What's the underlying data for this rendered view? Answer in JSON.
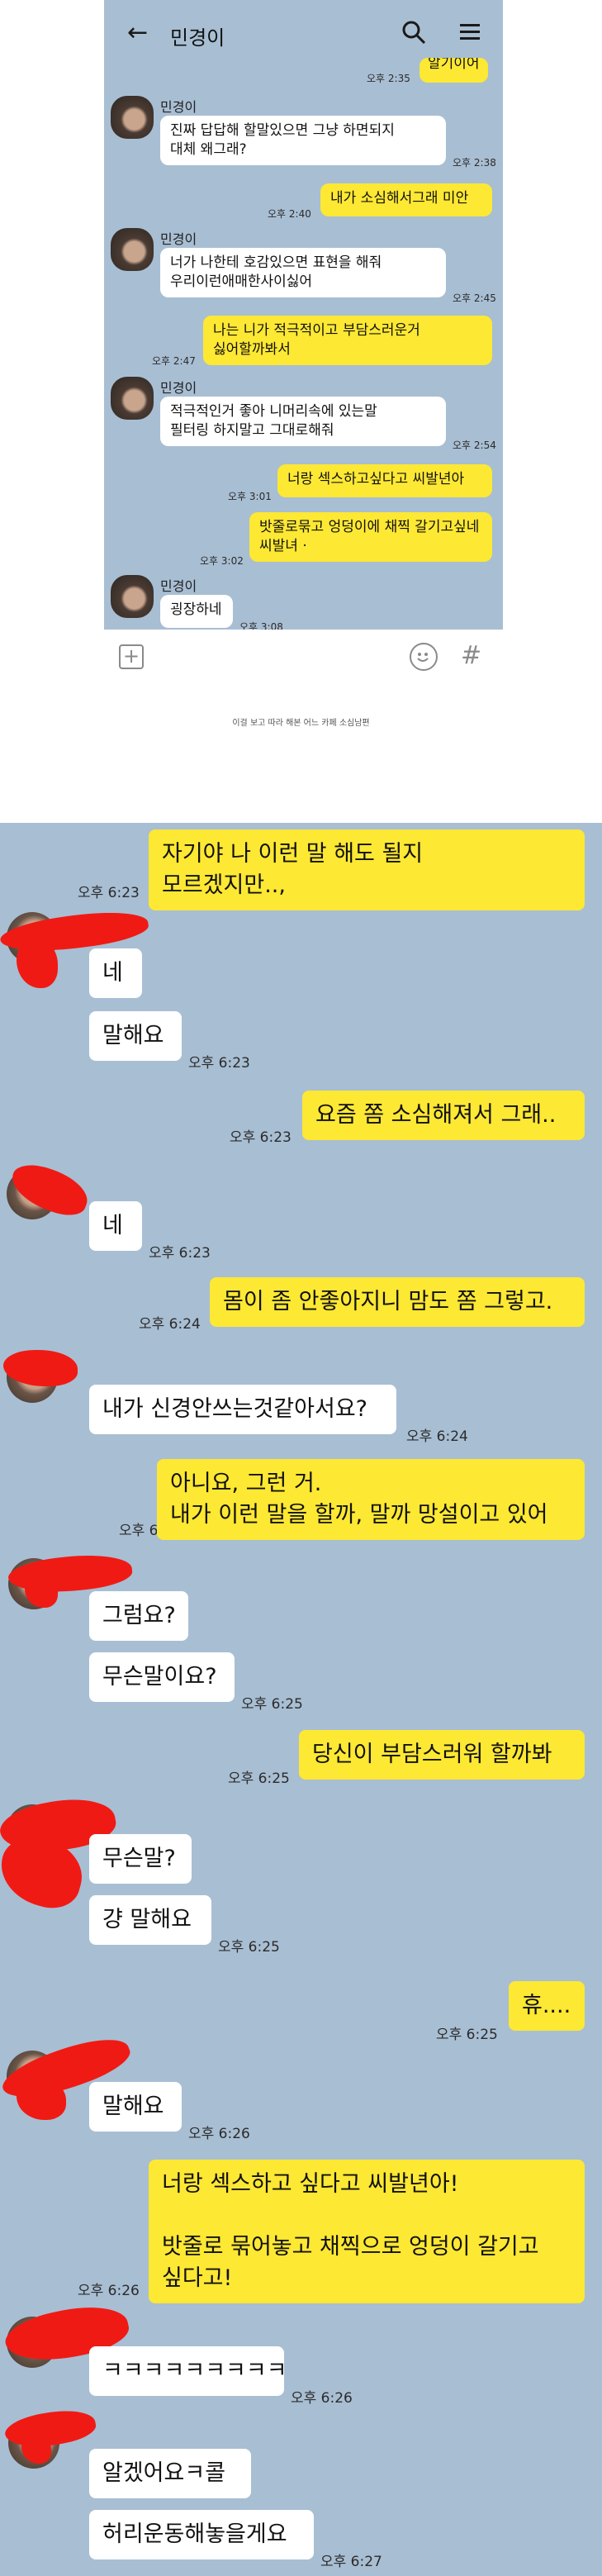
{
  "shot1": {
    "header": {
      "back_icon": "arrow-left-icon",
      "title": "민경이",
      "search_icon": "search-icon",
      "menu_icon": "hamburger-menu-icon"
    },
    "top_partial": {
      "time": "오후 2:35",
      "text": "알기이어"
    },
    "messages": [
      {
        "side": "in",
        "name": "민경이",
        "lines": [
          "진짜 답답해 할말있으면 그냥 하면되지",
          "대체 왜그래?"
        ],
        "time": "오후 2:38"
      },
      {
        "side": "out",
        "lines": [
          "내가 소심해서그래 미안"
        ],
        "time": "오후 2:40"
      },
      {
        "side": "in",
        "name": "민경이",
        "lines": [
          "너가 나한테 호감있으면 표현을 해줘",
          "우리이런애매한사이싫어"
        ],
        "time": "오후 2:45"
      },
      {
        "side": "out",
        "lines": [
          "나는 니가 적극적이고 부담스러운거",
          "싫어할까봐서"
        ],
        "time": "오후 2:47"
      },
      {
        "side": "in",
        "name": "민경이",
        "lines": [
          "적극적인거 좋아 니머리속에 있는말",
          "필터링 하지말고 그대로해줘"
        ],
        "time": "오후 2:54"
      },
      {
        "side": "out",
        "lines": [
          "너랑 섹스하고싶다고 씨발년아"
        ],
        "time": "오후 3:01"
      },
      {
        "side": "out",
        "lines": [
          "밧줄로묶고 엉덩이에 채찍 갈기고싶네",
          "씨발녀 ·"
        ],
        "time": "오후 3:02"
      },
      {
        "side": "in",
        "name": "민경이",
        "lines": [
          "굉장하네"
        ],
        "time": "오후 3:08"
      }
    ],
    "footer": {
      "plus_icon": "plus-square-icon",
      "emoji_icon": "smiley-icon",
      "hash_icon": "hash-icon"
    }
  },
  "caption": "이걸 보고 따라 해본 어느 카페 소심남편",
  "shot2": {
    "messages": [
      {
        "side": "out",
        "lines": [
          "자기야 나 이런 말 해도 될지",
          "모르겠지만..,"
        ],
        "time": "오후 6:23"
      },
      {
        "side": "in",
        "lines": [
          "네"
        ]
      },
      {
        "side": "in",
        "lines": [
          "말해요"
        ],
        "time": "오후 6:23"
      },
      {
        "side": "out",
        "lines": [
          "요즘 쫌 소심해져서 그래.."
        ],
        "time": "오후 6:23"
      },
      {
        "side": "in",
        "lines": [
          "네"
        ],
        "time": "오후 6:23"
      },
      {
        "side": "out",
        "lines": [
          "몸이 좀 안좋아지니 맘도 쫌 그렇고."
        ],
        "time": "오후 6:24"
      },
      {
        "side": "in",
        "lines": [
          "내가 신경안쓰는것같아서요?"
        ],
        "time": "오후 6:24"
      },
      {
        "side": "out",
        "lines": [
          "아니요, 그런 거.",
          "내가  이런 말을 할까, 말까 망설이고 있어"
        ],
        "time": "오후 6:25"
      },
      {
        "side": "in",
        "lines": [
          "그럼요?"
        ]
      },
      {
        "side": "in",
        "lines": [
          "무슨말이요?"
        ],
        "time": "오후 6:25"
      },
      {
        "side": "out",
        "lines": [
          "당신이 부담스러워 할까봐"
        ],
        "time": "오후 6:25"
      },
      {
        "side": "in",
        "lines": [
          "무슨말?"
        ]
      },
      {
        "side": "in",
        "lines": [
          "걍 말해요"
        ],
        "time": "오후 6:25"
      },
      {
        "side": "out",
        "lines": [
          "휴...."
        ],
        "time": "오후 6:25"
      },
      {
        "side": "in",
        "lines": [
          "말해요"
        ],
        "time": "오후 6:26"
      },
      {
        "side": "out",
        "lines": [
          "너랑 섹스하고 싶다고 씨발년아!",
          "",
          "밧줄로 묶어놓고 채찍으로 엉덩이 갈기고",
          "싶다고!"
        ],
        "time": "오후 6:26"
      },
      {
        "side": "in",
        "lines": [
          "ㅋㅋㅋㅋㅋㅋㅋㅋㅋ"
        ],
        "time": "오후 6:26"
      },
      {
        "side": "in",
        "lines": [
          "알겠어요ㅋ콜"
        ]
      },
      {
        "side": "in",
        "lines": [
          "허리운동해놓을게요"
        ],
        "time": "오후 6:27"
      }
    ]
  },
  "colors": {
    "chat_bg": "#a8bed3",
    "out_bubble": "#fde833",
    "in_bubble": "#ffffff",
    "redaction": "#f01a14"
  }
}
